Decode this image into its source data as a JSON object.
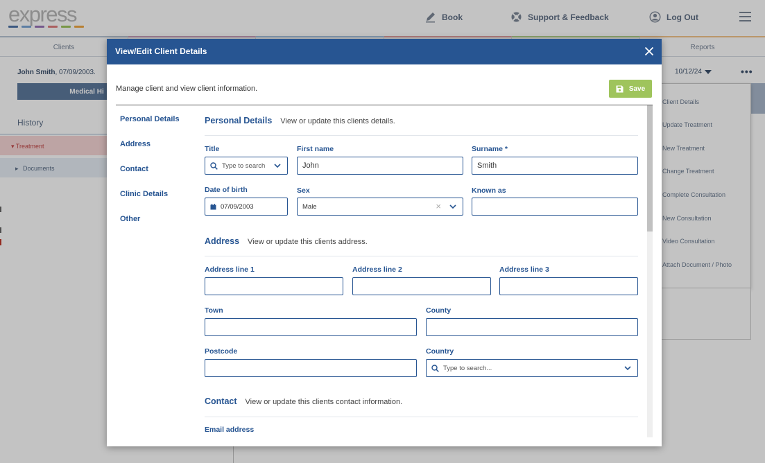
{
  "app": {
    "logo_text": "express",
    "logo_colors": [
      "#4f74a8",
      "#7aa5d6",
      "#9a73b8",
      "#e07e7e",
      "#9ec55c",
      "#f0a843"
    ],
    "nav": {
      "book": "Book",
      "support": "Support & Feedback",
      "logout": "Log Out"
    },
    "tabs": [
      {
        "label": "Clients",
        "color": "#b9c6d6"
      },
      {
        "label": "",
        "color": "#cda3c0"
      },
      {
        "label": "",
        "color": "#a8c4e3"
      },
      {
        "label": "",
        "color": "#e3a0a0"
      },
      {
        "label": "",
        "color": "#b5d38c"
      },
      {
        "label": "Reports",
        "color": "#f3c48a"
      }
    ],
    "client_name": "John Smith",
    "client_dob": ", 07/09/2003.",
    "medical_button": "Medical Hi",
    "history_title": "History",
    "tree": {
      "treatment": "Treatment",
      "documents": "Documents"
    },
    "date_selector": "10/12/24",
    "menu_items": [
      "Client Details",
      "Update Treatment",
      "New Treatment",
      "Change Treatment",
      "Complete Consultation",
      "New Consultation",
      "Video Consultation",
      "Attach Document / Photo"
    ]
  },
  "modal": {
    "title": "View/Edit Client Details",
    "description": "Manage client and view client information.",
    "save_label": "Save",
    "side_nav": [
      "Personal Details",
      "Address",
      "Contact",
      "Clinic Details",
      "Other"
    ],
    "personal": {
      "title": "Personal Details",
      "subtitle": "View or update this clients details.",
      "title_label": "Title",
      "title_placeholder": "Type to search",
      "first_name_label": "First name",
      "first_name_value": "John",
      "surname_label": "Surname *",
      "surname_value": "Smith",
      "dob_label": "Date of birth",
      "dob_value": "07/09/2003",
      "sex_label": "Sex",
      "sex_value": "Male",
      "known_as_label": "Known as",
      "known_as_value": ""
    },
    "address": {
      "title": "Address",
      "subtitle": "View or update this clients address.",
      "line1_label": "Address line 1",
      "line2_label": "Address line 2",
      "line3_label": "Address line 3",
      "town_label": "Town",
      "county_label": "County",
      "postcode_label": "Postcode",
      "country_label": "Country",
      "country_placeholder": "Type to search..."
    },
    "contact": {
      "title": "Contact",
      "subtitle": "View or update this clients contact information.",
      "email_label": "Email address"
    }
  }
}
